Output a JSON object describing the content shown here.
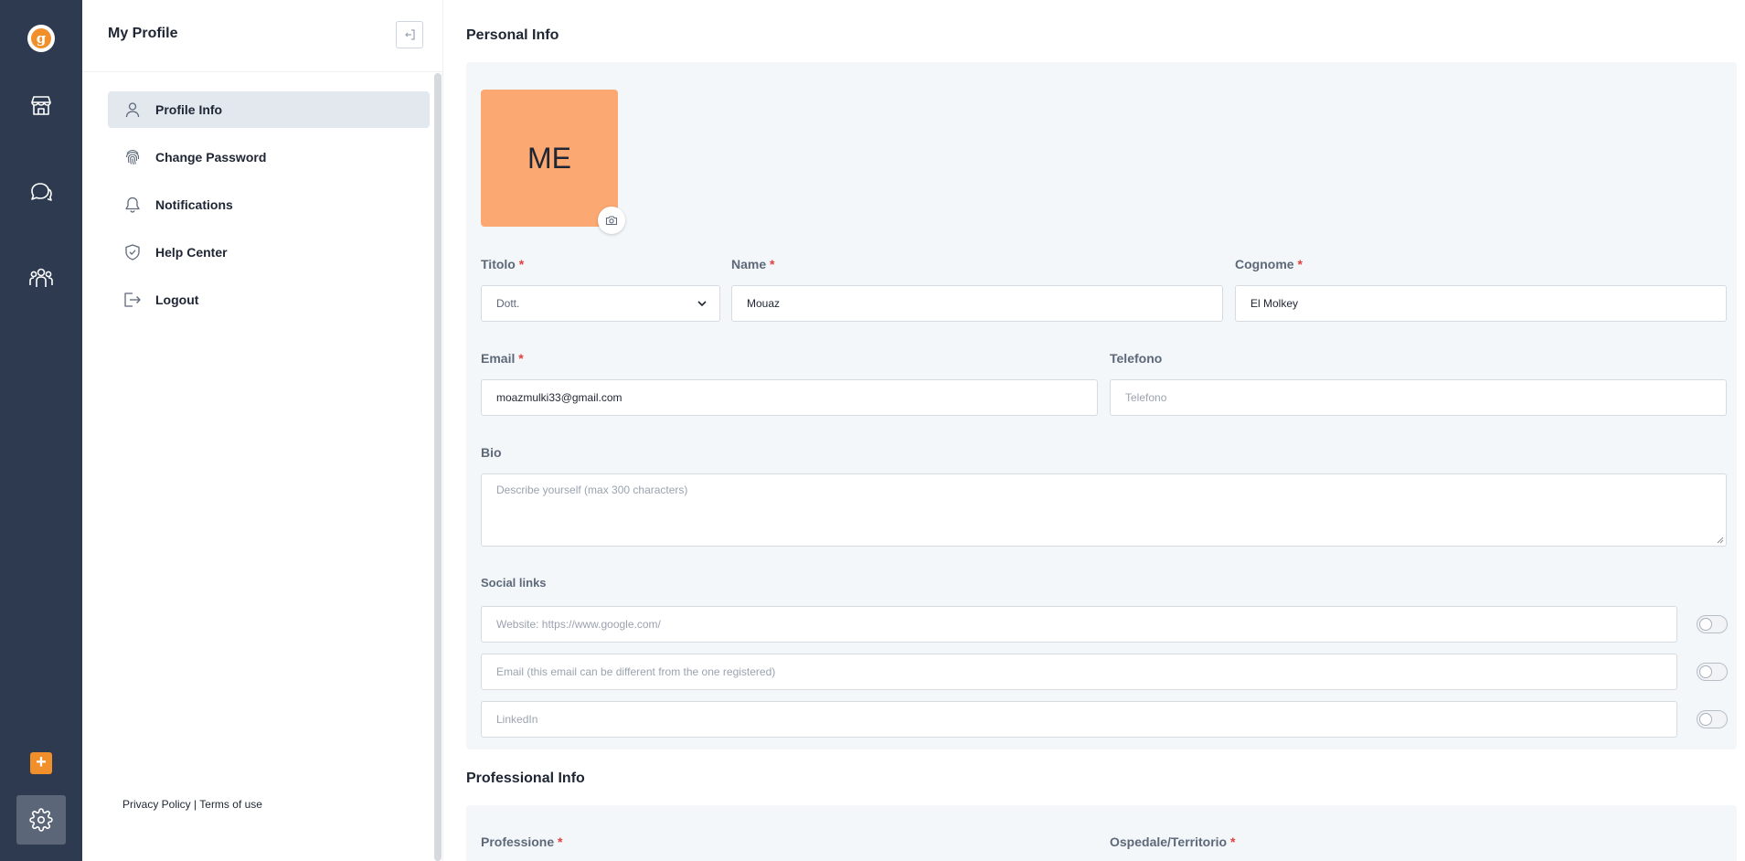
{
  "rail": {
    "logo_letter": "g",
    "icons": [
      "store-icon",
      "chat-icon",
      "community-icon"
    ],
    "plus_label": "+",
    "accent": "#f18f2b",
    "background": "#2d3a4f"
  },
  "sidebar": {
    "title": "My Profile",
    "items": [
      {
        "label": "Profile Info",
        "icon": "user-icon",
        "active": true
      },
      {
        "label": "Change Password",
        "icon": "fingerprint-icon",
        "active": false
      },
      {
        "label": "Notifications",
        "icon": "bell-icon",
        "active": false
      },
      {
        "label": "Help Center",
        "icon": "shield-check-icon",
        "active": false
      },
      {
        "label": "Logout",
        "icon": "logout-icon",
        "active": false
      }
    ],
    "footer": {
      "privacy": "Privacy Policy",
      "separator": " | ",
      "terms": "Terms of use"
    }
  },
  "personal": {
    "title": "Personal Info",
    "avatar_initials": "ME",
    "avatar_color": "#fba872",
    "titolo": {
      "label": "Titolo",
      "value": "Dott."
    },
    "name": {
      "label": "Name",
      "value": "Mouaz"
    },
    "cognome": {
      "label": "Cognome",
      "value": "El Molkey"
    },
    "email": {
      "label": "Email",
      "value": "moazmulki33@gmail.com"
    },
    "telefono": {
      "label": "Telefono",
      "placeholder": "Telefono"
    },
    "bio": {
      "label": "Bio",
      "placeholder": "Describe yourself (max 300 characters)"
    },
    "social": {
      "label": "Social links",
      "links": [
        {
          "placeholder": "Website: https://www.google.com/",
          "enabled": false
        },
        {
          "placeholder": "Email (this email can be different from the one registered)",
          "enabled": false
        },
        {
          "placeholder": "LinkedIn",
          "enabled": false
        }
      ]
    },
    "required_mark": "*"
  },
  "professional": {
    "title": "Professional Info",
    "professione": {
      "label": "Professione"
    },
    "ospedale": {
      "label": "Ospedale/Territorio"
    }
  }
}
